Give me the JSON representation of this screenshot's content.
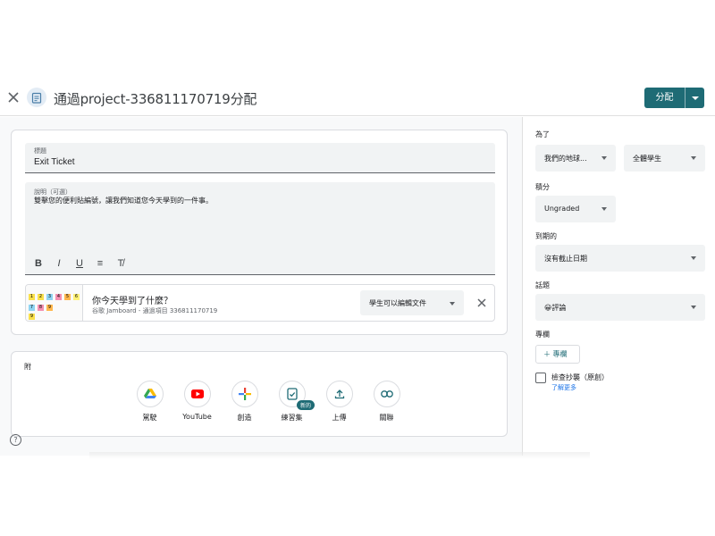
{
  "header": {
    "title": "通過project-336811170719分配",
    "assign_label": "分配"
  },
  "form": {
    "title_label": "標題",
    "title_value": "Exit Ticket",
    "desc_label": "說明（可選）",
    "desc_value": "雙擊您的便利貼編號，讓我們知道您今天學到的一件事。",
    "format_buttons": [
      "B",
      "I",
      "U",
      "≡",
      "T̸"
    ],
    "attachment": {
      "title": "你今天學到了什麼？",
      "subtitle": "谷歌 Jamboard - 通過項目 336811170719",
      "permission": "學生可以編輯文件"
    }
  },
  "add_section": {
    "label": "附",
    "tools": [
      {
        "label": "駕駛",
        "icon": "google-drive-icon"
      },
      {
        "label": "YouTube",
        "icon": "youtube-icon"
      },
      {
        "label": "創造",
        "icon": "create-plus-icon"
      },
      {
        "label": "練習集",
        "icon": "practice-set-icon"
      },
      {
        "label": "上傳",
        "icon": "upload-icon"
      },
      {
        "label": "關聯",
        "icon": "link-icon"
      }
    ],
    "new_badge": "新的"
  },
  "sidebar": {
    "for_label": "為了",
    "class_value": "我們的地球...",
    "students_value": "全體學生",
    "points_label": "積分",
    "points_value": "Ungraded",
    "due_label": "到期的",
    "due_value": "沒有截止日期",
    "topic_label": "話題",
    "topic_value": "😀評論",
    "rubric_label": "專欄",
    "rubric_button": "＋ 專欄",
    "originality_label": "檢查抄襲（原創）",
    "learn_more": "了解更多"
  },
  "help": "?",
  "colors": {
    "accent": "#1e6b75",
    "field_bg": "#f1f3f4",
    "border": "#dadce0"
  }
}
